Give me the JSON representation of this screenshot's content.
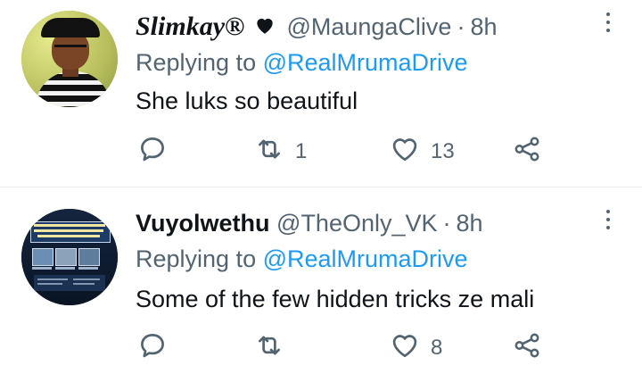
{
  "tweets": [
    {
      "display_name": "Slimkay®",
      "handle": "@MaungaClive",
      "separator": "·",
      "time": "8h",
      "replying_prefix": "Replying to",
      "replying_to": "@RealMrumaDrive",
      "text": "She luks so beautiful",
      "replies": "",
      "retweets": "1",
      "likes": "13"
    },
    {
      "display_name": "Vuyolwethu",
      "handle": "@TheOnly_VK",
      "separator": "·",
      "time": "8h",
      "replying_prefix": "Replying to",
      "replying_to": "@RealMrumaDrive",
      "text": "Some of the few hidden tricks ze mali",
      "replies": "",
      "retweets": "",
      "likes": "8"
    }
  ],
  "colors": {
    "text": "#0f1419",
    "muted": "#536471",
    "link": "#1d9bf0",
    "divider": "#e6ecf0"
  },
  "icons": {
    "reply": "reply-icon",
    "retweet": "retweet-icon",
    "like": "heart-icon",
    "share": "share-icon",
    "more": "more-vertical-icon",
    "verified_heart": "heart-emoji-icon"
  }
}
